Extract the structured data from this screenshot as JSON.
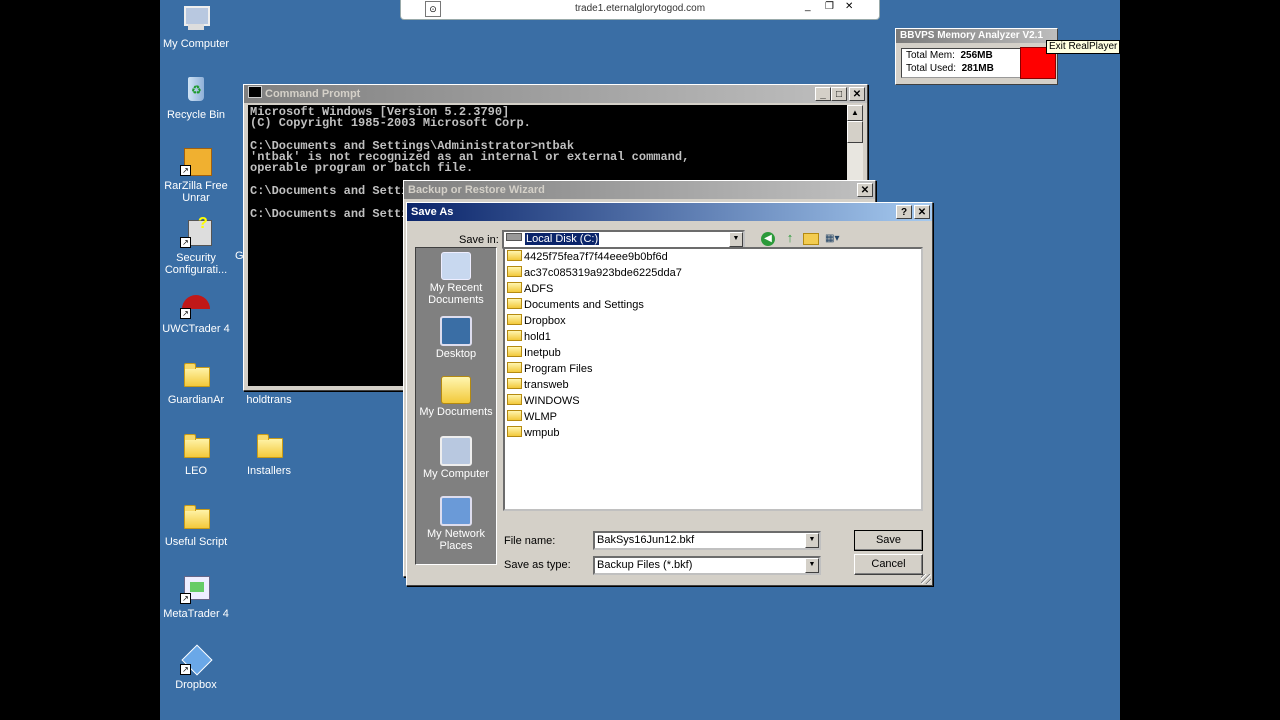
{
  "browser_bar": {
    "url": "trade1.eternalglorytogod.com"
  },
  "desktop_icons": [
    {
      "label": "My Computer",
      "icon": "my-computer-icon"
    },
    {
      "label": "Recycle Bin",
      "icon": "recycle-bin-icon"
    },
    {
      "label": "RarZilla Free\nUnrar",
      "icon": "rarzilla-icon"
    },
    {
      "label": "Security\nConfigurati...",
      "icon": "security-config-icon"
    },
    {
      "label": "UWCTrader 4",
      "icon": "uwctrader-icon"
    },
    {
      "label": "GuardianAr",
      "icon": "folder-icon"
    },
    {
      "label": "LEO",
      "icon": "folder-icon"
    },
    {
      "label": "Useful Script",
      "icon": "folder-icon"
    },
    {
      "label": "MetaTrader 4",
      "icon": "metatrader-icon"
    },
    {
      "label": "Dropbox",
      "icon": "dropbox-icon"
    },
    {
      "label": "holdtrans",
      "icon": "folder-icon"
    },
    {
      "label": "Installers",
      "icon": "folder-icon"
    },
    {
      "label": "G",
      "icon": "folder-icon"
    }
  ],
  "memory_analyzer": {
    "title": "BBVPS Memory Analyzer V2.1",
    "total_mem_label": "Total Mem:",
    "total_mem_value": "256MB",
    "total_used_label": "Total Used:",
    "total_used_value": "281MB",
    "status_color": "#ff0000",
    "tooltip": "Exit RealPlayer"
  },
  "cmd": {
    "title": "Command Prompt",
    "lines": [
      "Microsoft Windows [Version 5.2.3790]",
      "(C) Copyright 1985-2003 Microsoft Corp.",
      "",
      "C:\\Documents and Settings\\Administrator>ntbak",
      "'ntbak' is not recognized as an internal or external command,",
      "operable program or batch file.",
      "",
      "C:\\Documents and Settings\\Administrator>",
      "",
      "C:\\Documents and Settings\\Administrator>"
    ]
  },
  "wizard": {
    "title": "Backup or Restore Wizard"
  },
  "saveas": {
    "title": "Save As",
    "save_in_label": "Save in:",
    "save_in_value": "Local Disk (C:)",
    "places": [
      "My Recent\nDocuments",
      "Desktop",
      "My Documents",
      "My Computer",
      "My Network\nPlaces"
    ],
    "files": [
      "4425f75fea7f7f44eee9b0bf6d",
      "ac37c085319a923bde6225dda7",
      "ADFS",
      "Documents and Settings",
      "Dropbox",
      "hold1",
      "Inetpub",
      "Program Files",
      "transweb",
      "WINDOWS",
      "WLMP",
      "wmpub"
    ],
    "filename_label": "File name:",
    "filename_value": "BakSys16Jun12.bkf",
    "filetype_label": "Save as type:",
    "filetype_value": "Backup Files (*.bkf)",
    "save_button": "Save",
    "cancel_button": "Cancel"
  }
}
